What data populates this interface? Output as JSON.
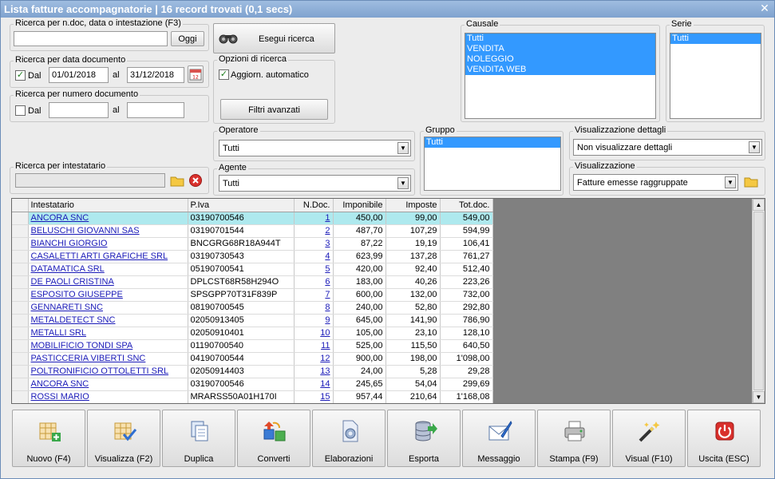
{
  "window": {
    "title": "Lista fatture accompagnatorie | 16 record trovati (0,1 secs)"
  },
  "search": {
    "title": "Ricerca per n.doc, data o intestazione (F3)",
    "value": "",
    "oggi_label": "Oggi",
    "run_label": "Esegui ricerca"
  },
  "date_search": {
    "title": "Ricerca per data documento",
    "dal_label": "Dal",
    "dal_checked": true,
    "from": "01/01/2018",
    "al_label": "al",
    "to": "31/12/2018"
  },
  "num_search": {
    "title": "Ricerca per numero documento",
    "dal_label": "Dal",
    "dal_checked": false,
    "from": "",
    "al_label": "al",
    "to": ""
  },
  "options": {
    "title": "Opzioni di ricerca",
    "auto_label": "Aggiorn. automatico",
    "auto_checked": true,
    "advanced_label": "Filtri avanzati"
  },
  "holder": {
    "title": "Ricerca per intestatario",
    "value": ""
  },
  "operatore": {
    "title": "Operatore",
    "value": "Tutti"
  },
  "agente": {
    "title": "Agente",
    "value": "Tutti"
  },
  "gruppo": {
    "title": "Gruppo",
    "items": [
      "Tutti"
    ]
  },
  "causale": {
    "title": "Causale",
    "items": [
      "Tutti",
      "VENDITA",
      "NOLEGGIO",
      "VENDITA WEB"
    ]
  },
  "serie": {
    "title": "Serie",
    "items": [
      "Tutti"
    ]
  },
  "dettagli": {
    "title": "Visualizzazione dettagli",
    "value": "Non visualizzare dettagli"
  },
  "visual": {
    "title": "Visualizzazione",
    "value": "Fatture emesse raggruppate"
  },
  "table": {
    "columns": [
      "Intestatario",
      "P.Iva",
      "N.Doc.",
      "Imponibile",
      "Imposte",
      "Tot.doc."
    ],
    "rows": [
      [
        "ANCORA SNC",
        "03190700546",
        "1",
        "450,00",
        "99,00",
        "549,00"
      ],
      [
        "BELUSCHI GIOVANNI SAS",
        "03190701544",
        "2",
        "487,70",
        "107,29",
        "594,99"
      ],
      [
        "BIANCHI GIORGIO",
        "BNCGRG68R18A944T",
        "3",
        "87,22",
        "19,19",
        "106,41"
      ],
      [
        "CASALETTI ARTI GRAFICHE SRL",
        "03190730543",
        "4",
        "623,99",
        "137,28",
        "761,27"
      ],
      [
        "DATAMATICA SRL",
        "05190700541",
        "5",
        "420,00",
        "92,40",
        "512,40"
      ],
      [
        "DE PAOLI CRISTINA",
        "DPLCST68R58H294O",
        "6",
        "183,00",
        "40,26",
        "223,26"
      ],
      [
        "ESPOSITO GIUSEPPE",
        "SPSGPP70T31F839P",
        "7",
        "600,00",
        "132,00",
        "732,00"
      ],
      [
        "GENNARETI SNC",
        "08190700545",
        "8",
        "240,00",
        "52,80",
        "292,80"
      ],
      [
        "METALDETECT SNC",
        "02050913405",
        "9",
        "645,00",
        "141,90",
        "786,90"
      ],
      [
        "METALLI SRL",
        "02050910401",
        "10",
        "105,00",
        "23,10",
        "128,10"
      ],
      [
        "MOBILIFICIO TONDI SPA",
        "01190700540",
        "11",
        "525,00",
        "115,50",
        "640,50"
      ],
      [
        "PASTICCERIA VIBERTI SNC",
        "04190700544",
        "12",
        "900,00",
        "198,00",
        "1'098,00"
      ],
      [
        "POLTRONIFICIO OTTOLETTI SRL",
        "02050914403",
        "13",
        "24,00",
        "5,28",
        "29,28"
      ],
      [
        "ANCORA SNC",
        "03190700546",
        "14",
        "245,65",
        "54,04",
        "299,69"
      ],
      [
        "ROSSI MARIO",
        "MRARSS50A01H170I",
        "15",
        "957,44",
        "210,64",
        "1'168,08"
      ]
    ]
  },
  "toolbar": {
    "nuovo": "Nuovo (F4)",
    "visualizza": "Visualizza (F2)",
    "duplica": "Duplica",
    "converti": "Converti",
    "elaborazioni": "Elaborazioni",
    "esporta": "Esporta",
    "messaggio": "Messaggio",
    "stampa": "Stampa (F9)",
    "visual": "Visual (F10)",
    "uscita": "Uscita (ESC)"
  }
}
